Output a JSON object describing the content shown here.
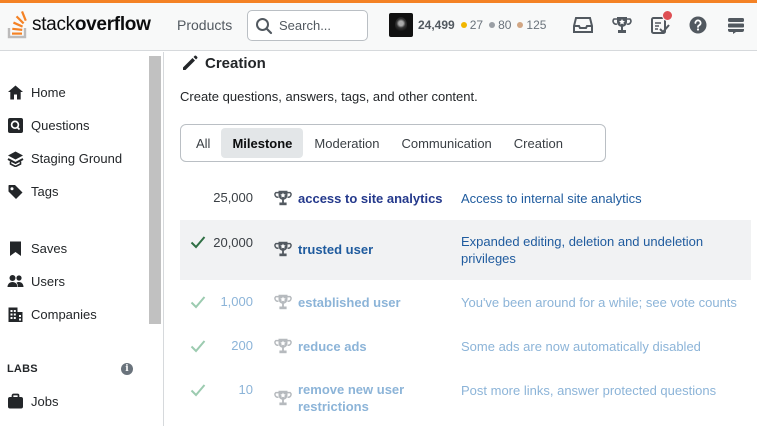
{
  "header": {
    "logo_light": "stack",
    "logo_bold": "overflow",
    "products_label": "Products",
    "search_placeholder": "Search...",
    "user": {
      "reputation": "24,499",
      "gold": "27",
      "silver": "80",
      "bronze": "125",
      "gold_color": "#f1b600",
      "silver_color": "#9a9fa5",
      "bronze_color": "#d1a684"
    },
    "icons": [
      "inbox-icon",
      "achievements-icon",
      "review-queue-icon",
      "help-icon",
      "site-switcher-icon"
    ]
  },
  "sidebar": {
    "items": [
      {
        "label": "Home",
        "icon": "home-icon"
      },
      {
        "label": "Questions",
        "icon": "questions-icon"
      },
      {
        "label": "Staging Ground",
        "icon": "staging-ground-icon"
      },
      {
        "label": "Tags",
        "icon": "tag-icon"
      },
      {
        "label": "Saves",
        "icon": "bookmark-icon"
      },
      {
        "label": "Users",
        "icon": "users-icon"
      },
      {
        "label": "Companies",
        "icon": "companies-icon"
      },
      {
        "label": "Jobs",
        "icon": "briefcase-icon"
      }
    ],
    "labs_title": "LABS",
    "labs_info": "i"
  },
  "main": {
    "title": "Creation",
    "description": "Create questions, answers, tags, and other content.",
    "tabs": [
      {
        "label": "All",
        "active": false
      },
      {
        "label": "Milestone",
        "active": true
      },
      {
        "label": "Moderation",
        "active": false
      },
      {
        "label": "Communication",
        "active": false
      },
      {
        "label": "Creation",
        "active": false
      }
    ],
    "privileges": [
      {
        "amount": "25,000",
        "name": "access to site analytics",
        "description": "Access to internal site analytics",
        "state": "locked"
      },
      {
        "amount": "20,000",
        "name": "trusted user",
        "description": "Expanded editing, deletion and undeletion privileges",
        "state": "current"
      },
      {
        "amount": "1,000",
        "name": "established user",
        "description": "You've been around for a while; see vote counts",
        "state": "earned"
      },
      {
        "amount": "200",
        "name": "reduce ads",
        "description": "Some ads are now automatically disabled",
        "state": "earned"
      },
      {
        "amount": "10",
        "name": "remove new user restrictions",
        "description": "Post more links, answer protected questions",
        "state": "earned"
      }
    ]
  },
  "colors": {
    "brand_orange": "#f48225",
    "check_green": "#2f6f44",
    "link_blue": "#1f5b9e",
    "notification_red": "#de4f54"
  }
}
